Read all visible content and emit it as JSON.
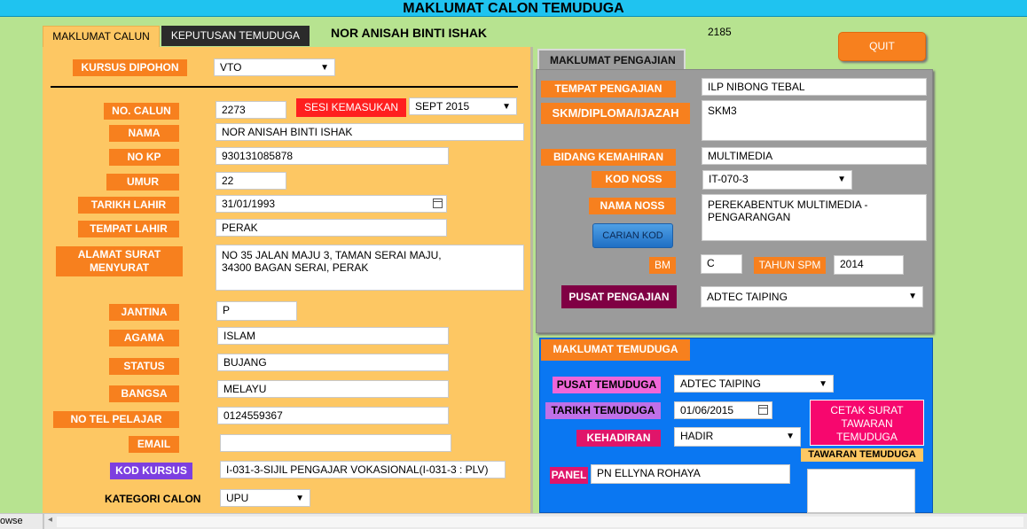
{
  "window": {
    "title": "MAKLUMAT CALON TEMUDUGA"
  },
  "tabs": [
    {
      "label": "MAKLUMAT CALUN"
    },
    {
      "label": "KEPUTUSAN TEMUDUGA"
    }
  ],
  "header": {
    "candidate_name": "NOR ANISAH BINTI ISHAK",
    "record_id": "2185",
    "quit_label": "QUIT"
  },
  "left": {
    "kursus_dipohon": {
      "label": "KURSUS DIPOHON",
      "value": "VTO"
    },
    "no_calun": {
      "label": "NO. CALUN",
      "value": "2273"
    },
    "sesi_kemasukan": {
      "label": "SESI KEMASUKAN",
      "value": "SEPT 2015"
    },
    "nama": {
      "label": "NAMA",
      "value": "NOR ANISAH BINTI ISHAK"
    },
    "no_kp": {
      "label": "NO KP",
      "value": "930131085878"
    },
    "umur": {
      "label": "UMUR",
      "value": "22"
    },
    "tarikh_lahir": {
      "label": "TARIKH LAHIR",
      "value": "31/01/1993"
    },
    "tempat_lahir": {
      "label": "TEMPAT LAHIR",
      "value": "PERAK"
    },
    "alamat": {
      "label": "ALAMAT SURAT MENYURAT",
      "value": "NO 35 JALAN MAJU 3, TAMAN SERAI MAJU,\n34300 BAGAN SERAI, PERAK"
    },
    "jantina": {
      "label": "JANTINA",
      "value": "P"
    },
    "agama": {
      "label": "AGAMA",
      "value": "ISLAM"
    },
    "status": {
      "label": "STATUS",
      "value": "BUJANG"
    },
    "bangsa": {
      "label": "BANGSA",
      "value": "MELAYU"
    },
    "no_tel": {
      "label": "NO TEL PELAJAR",
      "value": "0124559367"
    },
    "email": {
      "label": "EMAIL",
      "value": ""
    },
    "kod_kursus": {
      "label": "KOD KURSUS",
      "value": "I-031-3-SIJIL PENGAJAR VOKASIONAL(I-031-3 : PLV)"
    },
    "kategori_calon": {
      "label": "KATEGORI CALON",
      "value": "UPU"
    }
  },
  "pengajian": {
    "tab_label": "MAKLUMAT PENGAJIAN",
    "tempat_pengajian": {
      "label": "TEMPAT PENGAJIAN",
      "value": "ILP NIBONG TEBAL"
    },
    "skm": {
      "label": "SKM/DIPLOMA/IJAZAH",
      "value": "SKM3"
    },
    "bidang_kemahiran": {
      "label": "BIDANG KEMAHIRAN",
      "value": "MULTIMEDIA"
    },
    "kod_noss": {
      "label": "KOD NOSS",
      "value": "IT-070-3"
    },
    "nama_noss": {
      "label": "NAMA NOSS",
      "value": "PEREKABENTUK MULTIMEDIA -\nPENGARANGAN"
    },
    "carian_kod": "CARIAN KOD",
    "bm": {
      "label": "BM",
      "value": "C"
    },
    "tahun_spm": {
      "label": "TAHUN SPM",
      "value": "2014"
    },
    "pusat_pengajian": {
      "label": "PUSAT PENGAJIAN",
      "value": "ADTEC TAIPING"
    }
  },
  "temuduga": {
    "tab_label": "MAKLUMAT TEMUDUGA",
    "pusat_temuduga": {
      "label": "PUSAT TEMUDUGA",
      "value": "ADTEC TAIPING"
    },
    "tarikh_temuduga": {
      "label": "TARIKH TEMUDUGA",
      "value": "01/06/2015"
    },
    "kehadiran": {
      "label": "KEHADIRAN",
      "value": "HADIR"
    },
    "panel": {
      "label": "PANEL",
      "value": "PN ELLYNA ROHAYA"
    },
    "cetak_button": "CETAK SURAT TAWARAN TEMUDUGA",
    "tawaran_label": "TAWARAN TEMUDUGA",
    "tawaran_value": ""
  },
  "status_bar": {
    "text": "owse"
  },
  "colors": {
    "label_orange": "#f7801e",
    "panel_orange": "#fdc763",
    "blue": "#0a77f2",
    "gray": "#9b9b9b",
    "red": "#ff1f1f",
    "purple": "#7d3fe0",
    "maroon": "#800044",
    "pink": "#f7076e",
    "magenta": "#f066d8",
    "violet": "#c070e8"
  }
}
